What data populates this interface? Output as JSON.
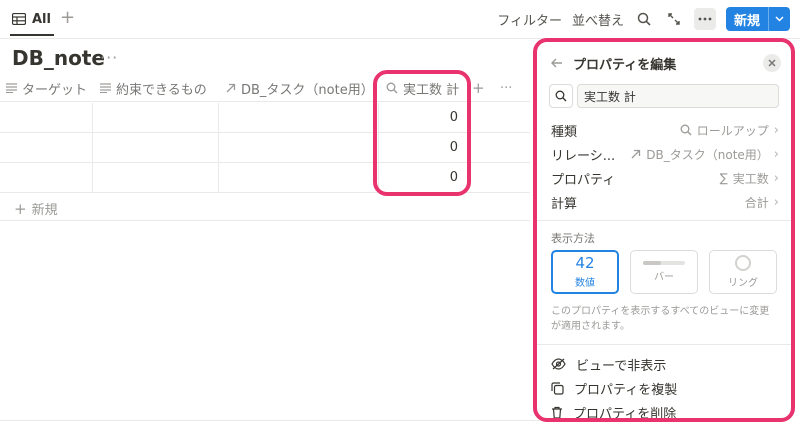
{
  "topbar": {
    "view_label": "All",
    "add_view": "+",
    "filter_label": "フィルター",
    "sort_label": "並べ替え",
    "new_label": "新規"
  },
  "database": {
    "title": "DB_note",
    "more": "···"
  },
  "table": {
    "columns": [
      {
        "label": "ターゲット",
        "icon": "text-lines-icon"
      },
      {
        "label": "約束できるもの",
        "icon": "text-lines-icon"
      },
      {
        "label": "DB_タスク（note用）",
        "icon": "relation-arrow-icon"
      },
      {
        "label": "実工数 計",
        "icon": "search-icon"
      }
    ],
    "add_column": "+",
    "more": "···",
    "rows": [
      {
        "value": "0"
      },
      {
        "value": "0"
      },
      {
        "value": "0"
      }
    ],
    "add_row": "新規"
  },
  "panel": {
    "title": "プロパティを編集",
    "name_value": "実工数 計",
    "rows": [
      {
        "key": "種類",
        "value": "ロールアップ",
        "icon": "search-icon"
      },
      {
        "key": "リレーシ...",
        "value": "DB_タスク（note用）",
        "icon": "relation-arrow-icon"
      },
      {
        "key": "プロパティ",
        "value": "実工数",
        "icon": "sigma-icon"
      },
      {
        "key": "計算",
        "value": "合計",
        "icon": ""
      }
    ],
    "display_label": "表示方法",
    "display_options": [
      {
        "graphic": "42",
        "label": "数値",
        "selected": true
      },
      {
        "graphic": "",
        "label": "バー",
        "selected": false
      },
      {
        "graphic": "",
        "label": "リング",
        "selected": false
      }
    ],
    "note": "このプロパティを表示するすべてのビューに変更が適用されます。",
    "actions": [
      {
        "label": "ビューで非表示",
        "icon": "eye-icon"
      },
      {
        "label": "プロパティを複製",
        "icon": "duplicate-icon"
      },
      {
        "label": "プロパティを削除",
        "icon": "trash-icon"
      }
    ]
  },
  "colors": {
    "accent": "#2383e2",
    "highlight": "#e8336e"
  }
}
